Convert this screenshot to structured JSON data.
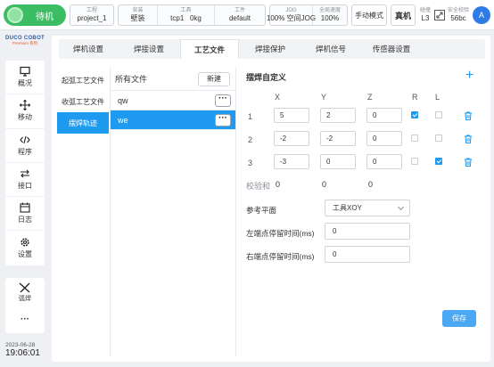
{
  "status": {
    "label": "待机"
  },
  "topbar": {
    "project": {
      "label": "工程",
      "value": "project_1"
    },
    "install": {
      "label": "安装",
      "value": "壁装"
    },
    "tool": {
      "label": "工具",
      "value": "tcp1",
      "weight": "0kg"
    },
    "workpiece": {
      "label": "工件",
      "value": "default"
    },
    "jog": {
      "label": "JOG",
      "value": "100%  空间JOG"
    },
    "speed": {
      "label": "全局速度",
      "value": "100%"
    },
    "mode_button": "手动模式",
    "real_button": "真机",
    "collision": {
      "label": "碰撞",
      "value": "L3"
    },
    "safety": {
      "label": "安全校验",
      "value": "56bc"
    },
    "avatar": "A"
  },
  "brand": {
    "name": "DUCO COBOT",
    "sub": "Premium 系列"
  },
  "sidebar": {
    "items": [
      {
        "label": "概况",
        "icon": "monitor-icon"
      },
      {
        "label": "移动",
        "icon": "move-arrows-icon"
      },
      {
        "label": "程序",
        "icon": "code-icon"
      },
      {
        "label": "接口",
        "icon": "swap-arrows-icon"
      },
      {
        "label": "日志",
        "icon": "calendar-icon"
      },
      {
        "label": "设置",
        "icon": "gear-icon"
      }
    ],
    "extra": {
      "label": "弧焊",
      "icon": "welding-torch-icon"
    },
    "more": "···"
  },
  "datetime": {
    "date": "2023-06-28",
    "time": "19:06:01"
  },
  "tabs": [
    "焊机设置",
    "焊接设置",
    "工艺文件",
    "焊接保护",
    "焊机信号",
    "传感器设置"
  ],
  "active_tab": "工艺文件",
  "categories": [
    "起弧工艺文件",
    "收弧工艺文件",
    "摆焊轨迹"
  ],
  "files": {
    "header": "所有文件",
    "new_button": "新建",
    "items": [
      "qw",
      "we"
    ],
    "more_button": "···"
  },
  "detail": {
    "title": "摆焊自定义",
    "add": "+",
    "columns": [
      "X",
      "Y",
      "Z",
      "R",
      "L"
    ],
    "rows": [
      {
        "index": "1",
        "x": "5",
        "y": "2",
        "z": "0",
        "r": true,
        "l": false
      },
      {
        "index": "2",
        "x": "-2",
        "y": "-2",
        "z": "0",
        "r": false,
        "l": false
      },
      {
        "index": "3",
        "x": "-3",
        "y": "0",
        "z": "0",
        "r": false,
        "l": true
      }
    ],
    "checksum": {
      "label": "校验和",
      "x": "0",
      "y": "0",
      "z": "0"
    },
    "ref_plane": {
      "label": "参考平面",
      "value": "工具XOY"
    },
    "left_dwell": {
      "label": "左端点停留时间(ms)",
      "value": "0"
    },
    "right_dwell": {
      "label": "右端点停留时间(ms)",
      "value": "0"
    },
    "save_button": "保存"
  },
  "colors": {
    "accent": "#1e9bf0",
    "status_green": "#3dbd63",
    "save": "#4aa8f4"
  }
}
